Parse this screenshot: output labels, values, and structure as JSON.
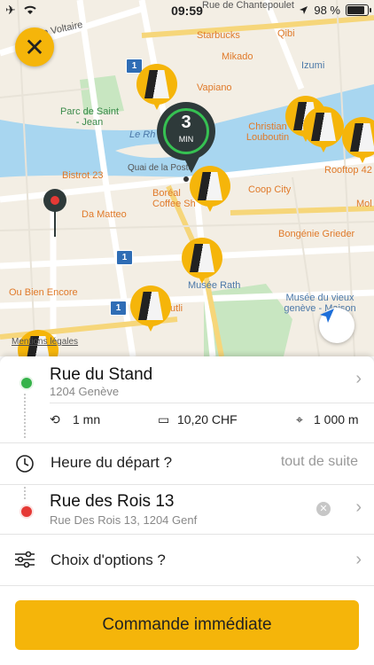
{
  "status_bar": {
    "time": "09:59",
    "battery": "98 %"
  },
  "map": {
    "labels": {
      "rue_chantepoulet": "Rue de Chantepoulet",
      "rue_voltaire": "Rue Voltaire",
      "starbucks": "Starbucks",
      "qibi": "Qibi",
      "mikado": "Mikado",
      "izumi": "Izumi",
      "parc": "Parc de Saint - Jean",
      "vapiano": "Vapiano",
      "le_rhone": "Le Rh",
      "louboutin": "Christian Louboutin",
      "bistrot": "Bistrot 23",
      "quai": "Quai de la Poste",
      "boreal": "Boréal Coffee Sh",
      "rooftop": "Rooftop 42",
      "coop": "Coop City",
      "mol": "Mol",
      "da_matteo": "Da Matteo",
      "bongenie": "Bongénie Grieder",
      "musee_rath": "Musée Rath",
      "ou_bien": "Ou Bien Encore",
      "musee_vieux": "Musée du vieux genève - Maison",
      "utli": "utli",
      "mentions": "Mentions légales"
    },
    "eta": {
      "value": "3",
      "unit": "MIN"
    },
    "badge_number": "1",
    "colors": {
      "accent": "#f5b50a",
      "water": "#a8d6f0",
      "park": "#c8e6c1",
      "pin_dark": "#2e3a3a",
      "eta_ring": "#36c152"
    }
  },
  "panel": {
    "pickup": {
      "title": "Rue du Stand",
      "subtitle": "1204 Genève"
    },
    "stats": {
      "duration": "1 mn",
      "price": "10,20 CHF",
      "distance": "1 000 m"
    },
    "departure": {
      "label": "Heure du départ ?",
      "value": "tout de suite"
    },
    "destination": {
      "title": "Rue des Rois 13",
      "subtitle": "Rue Des Rois 13, 1204 Genf"
    },
    "options": {
      "label": "Choix d'options ?"
    },
    "order_button": "Commande immédiate"
  }
}
